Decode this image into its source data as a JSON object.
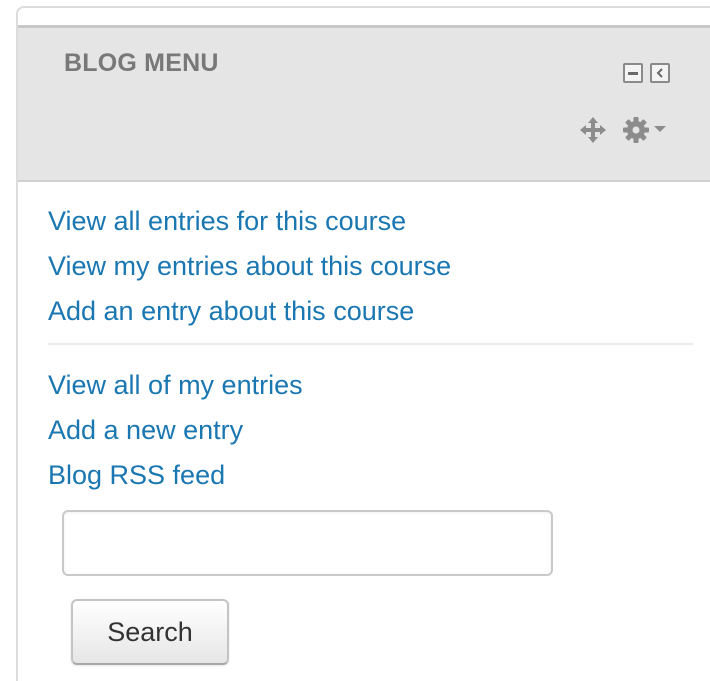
{
  "block": {
    "title": "BLOG MENU",
    "controls": {
      "hide_icon": "minus-square-icon",
      "dock_icon": "chevron-left-square-icon",
      "move_icon": "move-arrows-icon",
      "actions_icon": "gear-icon",
      "actions_caret": "caret-down-icon"
    }
  },
  "course_links": [
    {
      "label": "View all entries for this course"
    },
    {
      "label": "View my entries about this course"
    },
    {
      "label": "Add an entry about this course"
    }
  ],
  "user_links": [
    {
      "label": "View all of my entries"
    },
    {
      "label": "Add a new entry"
    },
    {
      "label": "Blog RSS feed"
    }
  ],
  "search": {
    "value": "",
    "placeholder": "",
    "button_label": "Search"
  },
  "colors": {
    "link": "#1a77b2",
    "header_bg": "#e5e5e5",
    "title": "#787878"
  }
}
